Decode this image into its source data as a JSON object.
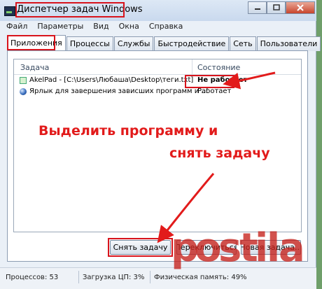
{
  "window": {
    "title": "Диспетчер задач Windows"
  },
  "menu": [
    "Файл",
    "Параметры",
    "Вид",
    "Окна",
    "Справка"
  ],
  "tabs": [
    "Приложения",
    "Процессы",
    "Службы",
    "Быстродействие",
    "Сеть",
    "Пользователи"
  ],
  "table": {
    "headers": {
      "task": "Задача",
      "status": "Состояние"
    },
    "rows": [
      {
        "name": "AkelPad - [C:\\Users\\Любаша\\Desktop\\теги.txt]",
        "status": "Не работает",
        "icon": "akelpad-icon"
      },
      {
        "name": "Ярлык для завершения зависших программ и ...",
        "status": "Работает",
        "icon": "globe-icon"
      }
    ]
  },
  "annotation": {
    "line1": "Выделить программу и",
    "line2": "снять задачу"
  },
  "buttons": {
    "end_task": "Снять задачу",
    "switch": "Переключиться",
    "new_task": "Новая задача..."
  },
  "statusbar": {
    "processes": "Процессов: 53",
    "cpu": "Загрузка ЦП: 3%",
    "memory": "Физическая память: 49%"
  },
  "watermark": "postila.ru",
  "colors": {
    "highlight": "#d8141c",
    "annotation_text": "#e21b1b",
    "background": "#6f9f6a",
    "window": "#eaf0f7"
  }
}
